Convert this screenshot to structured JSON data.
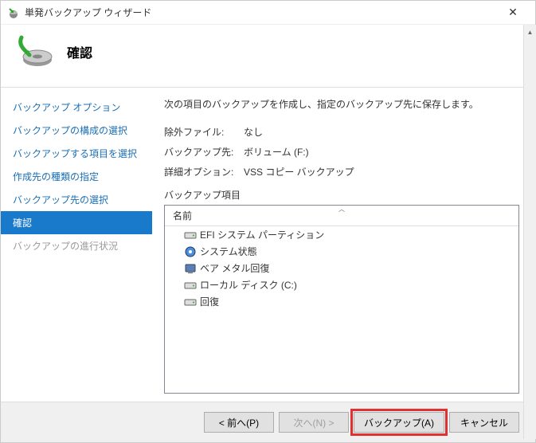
{
  "titlebar": {
    "title": "単発バックアップ ウィザード"
  },
  "header": {
    "title": "確認"
  },
  "sidebar": {
    "items": [
      {
        "label": "バックアップ オプション",
        "state": "link"
      },
      {
        "label": "バックアップの構成の選択",
        "state": "link"
      },
      {
        "label": "バックアップする項目を選択",
        "state": "link"
      },
      {
        "label": "作成先の種類の指定",
        "state": "link"
      },
      {
        "label": "バックアップ先の選択",
        "state": "link"
      },
      {
        "label": "確認",
        "state": "active"
      },
      {
        "label": "バックアップの進行状況",
        "state": "disabled"
      }
    ]
  },
  "content": {
    "description": "次の項目のバックアップを作成し、指定のバックアップ先に保存します。",
    "rows": [
      {
        "label": "除外ファイル:",
        "value": "なし"
      },
      {
        "label": "バックアップ先:",
        "value": "ボリューム (F:)"
      },
      {
        "label": "詳細オプション:",
        "value": "VSS コピー バックアップ"
      }
    ],
    "items_label": "バックアップ項目",
    "list_header": "名前",
    "items": [
      {
        "icon": "drive",
        "label": "EFI システム パーティション"
      },
      {
        "icon": "system",
        "label": "システム状態"
      },
      {
        "icon": "baremetal",
        "label": "ベア メタル回復"
      },
      {
        "icon": "drive",
        "label": "ローカル ディスク (C:)"
      },
      {
        "icon": "drive",
        "label": "回復"
      }
    ]
  },
  "footer": {
    "prev": "< 前へ(P)",
    "next": "次へ(N) >",
    "backup": "バックアップ(A)",
    "cancel": "キャンセル"
  }
}
